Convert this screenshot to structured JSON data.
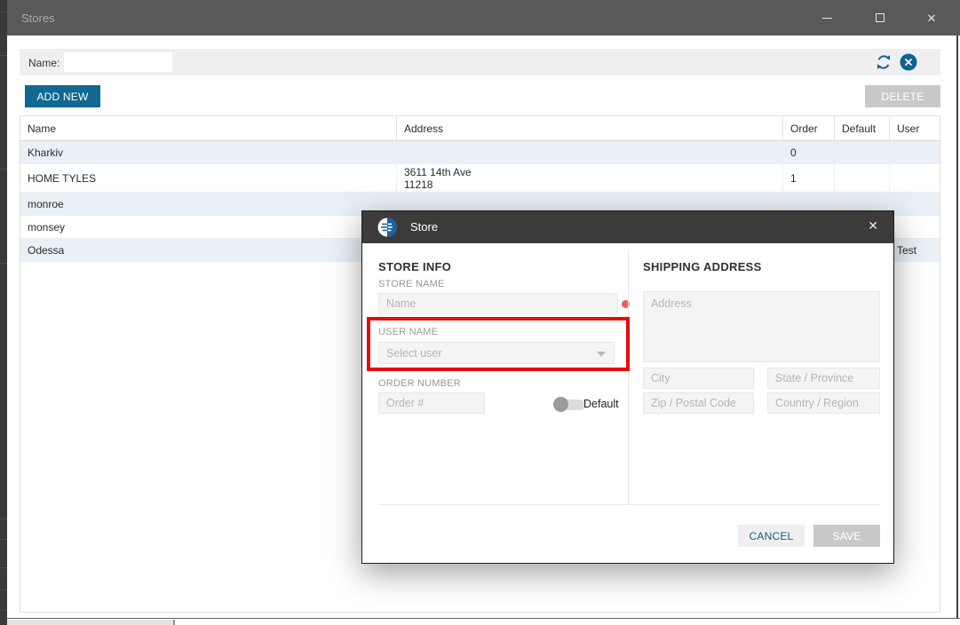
{
  "window": {
    "title": "Stores",
    "close_glyph": "✕"
  },
  "filter": {
    "name_label": "Name:",
    "name_value": ""
  },
  "actions": {
    "add_new": "ADD NEW",
    "delete": "DELETE"
  },
  "table": {
    "columns": [
      "Name",
      "Address",
      "Order",
      "Default",
      "User"
    ],
    "rows": [
      {
        "name": "Kharkiv",
        "address_line1": "",
        "address_line2": "",
        "order": "0",
        "default": "",
        "user": ""
      },
      {
        "name": "HOME TYLES",
        "address_line1": "3611 14th Ave",
        "address_line2": "11218",
        "order": "1",
        "default": "",
        "user": ""
      },
      {
        "name": "monroe",
        "address_line1": "",
        "address_line2": "",
        "order": "",
        "default": "",
        "user": ""
      },
      {
        "name": "monsey",
        "address_line1": "",
        "address_line2": "",
        "order": "",
        "default": "",
        "user": ""
      },
      {
        "name": "Odessa",
        "address_line1": "",
        "address_line2": "",
        "order": "",
        "default": "",
        "user": "Test"
      }
    ]
  },
  "dialog": {
    "title": "Store",
    "close_glyph": "✕",
    "store_info": {
      "heading": "STORE INFO",
      "store_name_label": "STORE NAME",
      "store_name_placeholder": "Name",
      "user_name_label": "USER NAME",
      "user_select_placeholder": "Select user",
      "order_number_label": "ORDER NUMBER",
      "order_placeholder": "Order #",
      "default_toggle_label": "Default",
      "default_toggle_state": "off"
    },
    "shipping": {
      "heading": "SHIPPING ADDRESS",
      "address_placeholder": "Address",
      "city_placeholder": "City",
      "state_placeholder": "State / Province",
      "zip_placeholder": "Zip / Postal Code",
      "country_placeholder": "Country / Region"
    },
    "footer": {
      "cancel": "CANCEL",
      "save": "SAVE"
    }
  },
  "colors": {
    "accent_blue": "#116890",
    "main_titlebar": "#595959",
    "dialog_titlebar": "#3b3b3b",
    "annotation_red": "#e60b0b",
    "validation_dot_red": "#f15b5b",
    "row_alt_blue": "#e9f1f7",
    "disabled_gray": "#c9c9c9"
  }
}
